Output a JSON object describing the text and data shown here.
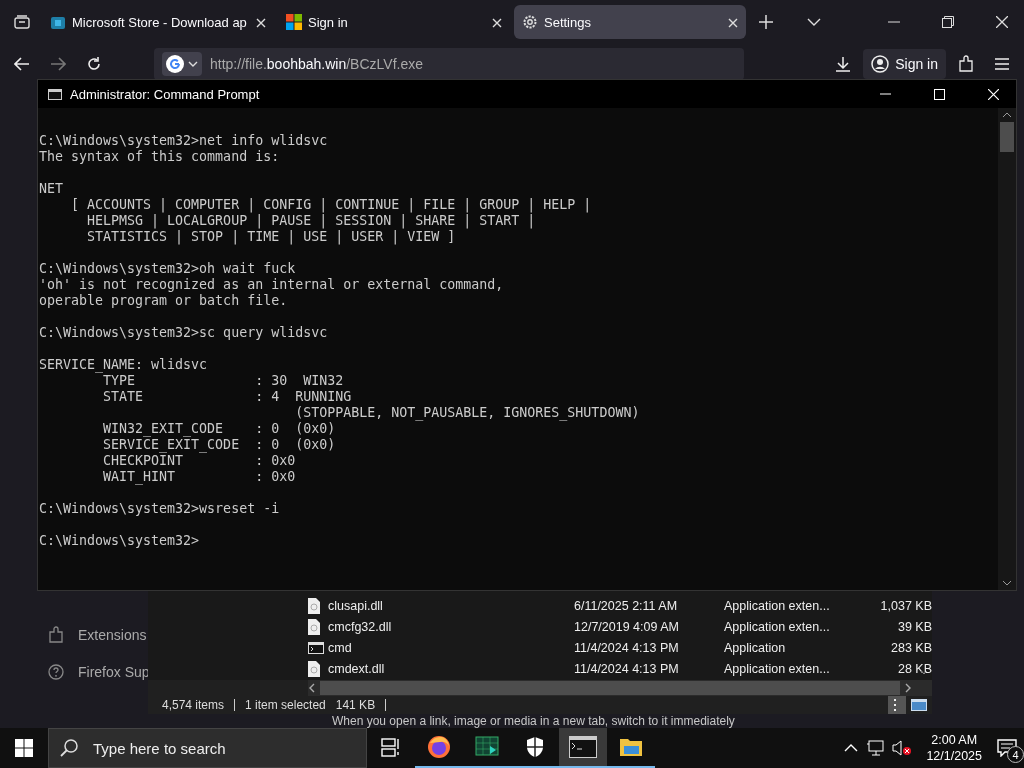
{
  "browser": {
    "tabs": [
      {
        "title": "Microsoft Store - Download ap",
        "kind": "store",
        "selected": false
      },
      {
        "title": "Sign in",
        "kind": "microsoft",
        "selected": false
      },
      {
        "title": "Settings",
        "kind": "gear",
        "selected": true
      }
    ],
    "url": "http://file.**boohbah.win**/BCzLVf.exe",
    "sign_in": "Sign in"
  },
  "settings_page": {
    "sidebar": [
      {
        "label": "Extensions",
        "kind": "puzzle"
      },
      {
        "label": "Firefox Sup",
        "kind": "help"
      }
    ],
    "text": "When you open a link, image or media in a new tab, switch to it immediately"
  },
  "terminal": {
    "title": "Administrator: Command Prompt",
    "blocks": [
      [
        "C:\\Windows\\system32>net info wlidsvc",
        "The syntax of this command is:"
      ],
      [
        "NET",
        "    [ ACCOUNTS | COMPUTER | CONFIG | CONTINUE | FILE | GROUP | HELP |",
        "      HELPMSG | LOCALGROUP | PAUSE | SESSION | SHARE | START |",
        "      STATISTICS | STOP | TIME | USE | USER | VIEW ]"
      ],
      [
        "C:\\Windows\\system32>oh wait fuck",
        "'oh' is not recognized as an internal or external command,",
        "operable program or batch file."
      ],
      [
        "C:\\Windows\\system32>sc query wlidsvc"
      ],
      [
        "SERVICE_NAME: wlidsvc",
        "        TYPE               : 30  WIN32",
        "        STATE              : 4  RUNNING",
        "                                (STOPPABLE, NOT_PAUSABLE, IGNORES_SHUTDOWN)",
        "        WIN32_EXIT_CODE    : 0  (0x0)",
        "        SERVICE_EXIT_CODE  : 0  (0x0)",
        "        CHECKPOINT         : 0x0",
        "        WAIT_HINT          : 0x0"
      ],
      [
        "C:\\Windows\\system32>wsreset -i"
      ],
      [
        "C:\\Windows\\system32>"
      ]
    ]
  },
  "explorer": {
    "rows": [
      {
        "name": "clusapi.dll",
        "date": "6/11/2025 2:11 AM",
        "type": "Application exten...",
        "size": "1,037 KB",
        "kind": "dll"
      },
      {
        "name": "cmcfg32.dll",
        "date": "12/7/2019 4:09 AM",
        "type": "Application exten...",
        "size": "39 KB",
        "kind": "dll"
      },
      {
        "name": "cmd",
        "date": "11/4/2024 4:13 PM",
        "type": "Application",
        "size": "283 KB",
        "kind": "console"
      },
      {
        "name": "cmdext.dll",
        "date": "11/4/2024 4:13 PM",
        "type": "Application exten...",
        "size": "28 KB",
        "kind": "dll"
      }
    ],
    "status": {
      "items": "4,574 items",
      "selected": "1 item selected",
      "size": "141 KB"
    }
  },
  "taskbar": {
    "search_placeholder": "Type here to search",
    "apps": [
      {
        "kind": "firefox",
        "selected": false
      },
      {
        "kind": "monitor",
        "selected": false
      },
      {
        "kind": "shield",
        "selected": false
      },
      {
        "kind": "console",
        "selected": true
      },
      {
        "kind": "folder",
        "selected": false
      }
    ],
    "time": "2:00 AM",
    "date": "12/1/2025",
    "notifications": "4"
  }
}
